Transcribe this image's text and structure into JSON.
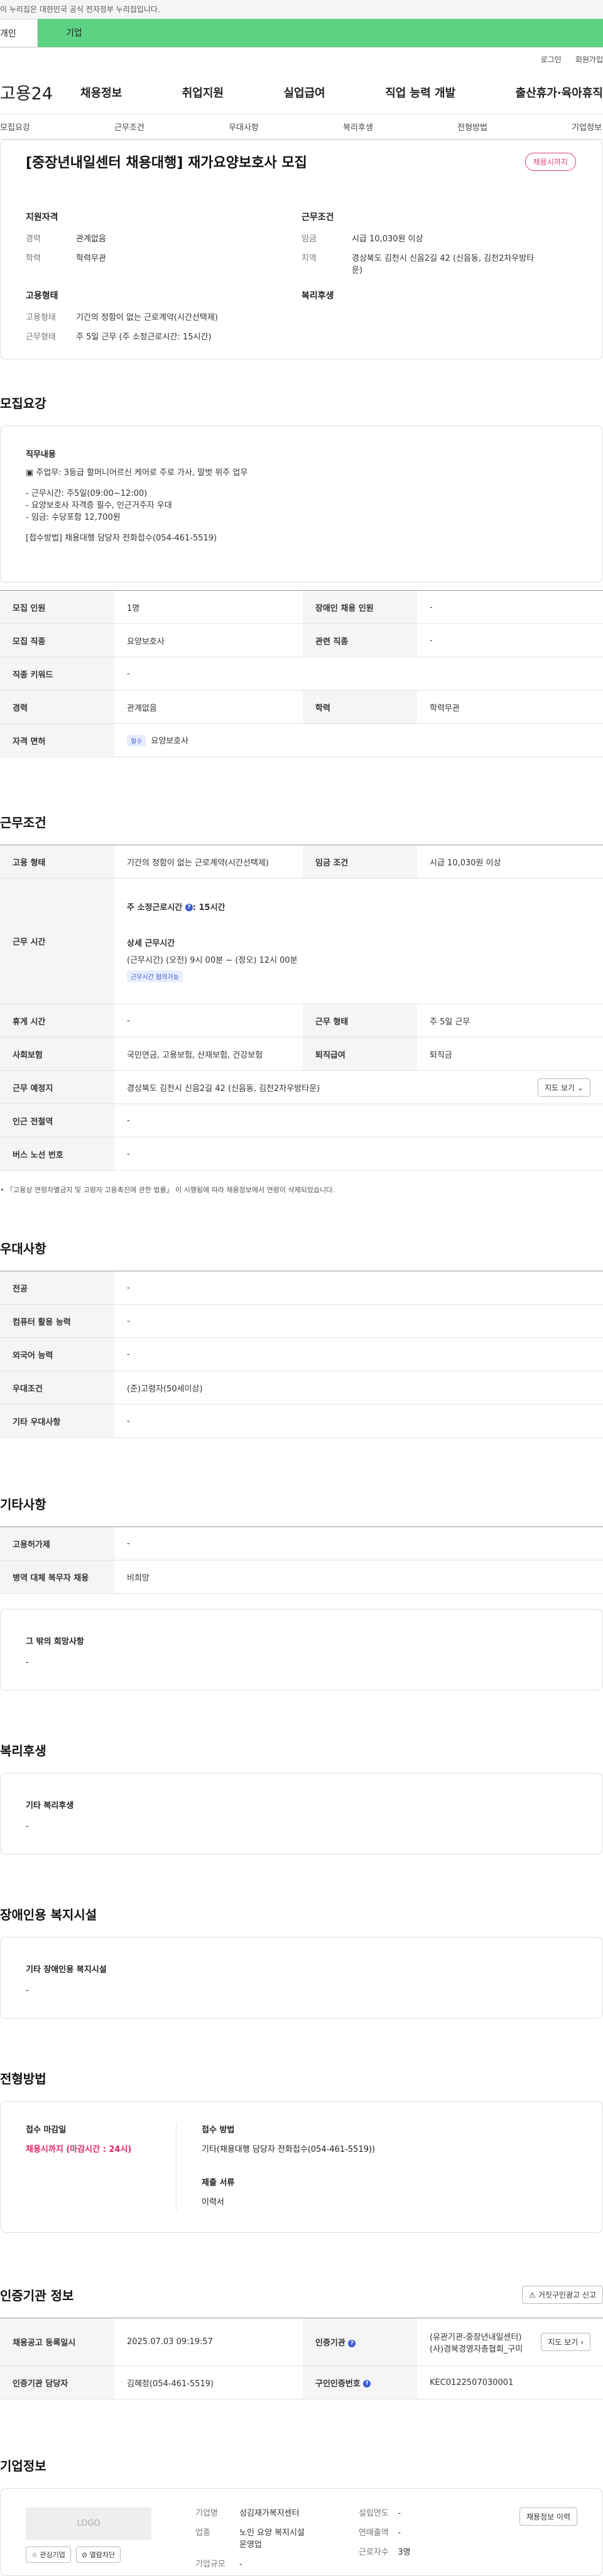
{
  "notice": "이 누리집은 대한민국 공식 전자정부 누리집입니다.",
  "tabs": {
    "personal": "개인",
    "company": "기업"
  },
  "util": {
    "login": "로그인",
    "join": "회원가입"
  },
  "logo": "고용24",
  "gnb": [
    "채용정보",
    "취업지원",
    "실업급여",
    "직업 능력 개발",
    "출산휴가·육아휴직"
  ],
  "lnb": [
    "모집요강",
    "근무조건",
    "우대사항",
    "복리후생",
    "전형방법",
    "기업정보"
  ],
  "summary": {
    "title": "[중장년내일센터 채용대행] 재가요양보호사 모집",
    "badge": "채용시까지",
    "qual_title": "지원자격",
    "cond_title": "근무조건",
    "emp_title": "고용형태",
    "welfare_title": "복리후생",
    "qual": [
      {
        "k": "경력",
        "v": "관계없음"
      },
      {
        "k": "학력",
        "v": "학력무관"
      }
    ],
    "cond": [
      {
        "k": "임금",
        "v": "시급 10,030원 이상"
      },
      {
        "k": "지역",
        "v": "경상북도 김천시 신음2길 42 (신음동, 김천2차우방타운)"
      }
    ],
    "emp": [
      {
        "k": "고용형태",
        "v": "기간의 정함이 없는 근로계약(시간선택제)"
      },
      {
        "k": "근무형태",
        "v": "주 5일 근무 (주 소정근로시간: 15시간)"
      }
    ]
  },
  "recruit": {
    "title": "모집요강",
    "duty_title": "직무내용",
    "duty_lines": [
      "▣ 주업무: 3등급 할머니어르신 케어로 주로 가사, 말벗 위주 업무",
      "",
      "- 근무시간: 주5일(09:00~12:00)",
      "- 요양보호사 자격증 필수, 인근거주자 우대",
      "- 임금: 수당포함 12,700원",
      "",
      "[접수방법] 채용대행 담당자 전화접수(054-461-5519)"
    ],
    "rows": {
      "h_people": "모집 인원",
      "people": "1명",
      "h_disabled": "장애인 채용 인원",
      "disabled": "-",
      "h_job": "모집 직종",
      "job": "요양보호사",
      "h_related": "관련 직종",
      "related": "-",
      "h_keyword": "직종 키워드",
      "keyword": "-",
      "h_career": "경력",
      "career": "관계없음",
      "h_edu": "학력",
      "edu": "학력무관",
      "h_license": "자격 면허",
      "license_tag": "필수",
      "license": "요양보호사"
    }
  },
  "work": {
    "title": "근무조건",
    "h_emp": "고용 형태",
    "emp": "기간의 정함이 없는 근로계약(시간선택제)",
    "h_wage": "임금 조건",
    "wage": "시급 10,030원 이상",
    "h_time": "근무 시간",
    "time_label": "주 소정근로시간",
    "time_value": ": 15시간",
    "time_detail_title": "상세 근무시간",
    "time_detail": "(근무시간) (오전) 9시 00분 ~ (정오) 12시 00분",
    "time_tag": "근무시간 협의가능",
    "h_holiday": "휴게 시간",
    "holiday": "-",
    "h_shape": "근무 형태",
    "shape": "주 5일 근무",
    "h_insure": "사회보험",
    "insure": "국민연금, 고용보험, 산재보험, 건강보험",
    "h_retire": "퇴직급여",
    "retire": "퇴직금",
    "h_place": "근무 예정지",
    "place": "경상북도 김천시 신음2길 42 (신음동, 김천2차우방타운)",
    "map_btn": "지도 보기",
    "h_subway": "인근 전철역",
    "subway": "-",
    "h_bus": "버스 노선 번호",
    "bus": "-",
    "note": "• 「고용상 연령차별금지 및 고령자 고용촉진에 관한 법률」 이 시행됨에 따라 채용정보에서 연령이 삭제되었습니다."
  },
  "prefer": {
    "title": "우대사항",
    "rows": [
      {
        "k": "전공",
        "v": "-"
      },
      {
        "k": "컴퓨터 활용 능력",
        "v": "-"
      },
      {
        "k": "외국어 능력",
        "v": "-"
      },
      {
        "k": "우대조건",
        "v": "(준)고령자(50세이상)"
      },
      {
        "k": "기타 우대사항",
        "v": "-"
      }
    ]
  },
  "etc": {
    "title": "기타사항",
    "rows": [
      {
        "k": "고용허가제",
        "v": "-"
      },
      {
        "k": "병역 대체 복무자 채용",
        "v": "비희망"
      }
    ],
    "hope_title": "그 밖의 희망사항",
    "hope": "-"
  },
  "welfare": {
    "title": "복리후생",
    "box_title": "기타 복리후생",
    "box": "-"
  },
  "facility": {
    "title": "장애인용 복지시설",
    "box_title": "기타 장애인용 복지시설",
    "box": "-"
  },
  "process": {
    "title": "전형방법",
    "deadline_title": "접수 마감일",
    "deadline": "채용시까지 (마감시간 : 24시)",
    "method_title": "접수 방법",
    "method": "기타(채용대행 담당자 전화접수(054-461-5519))",
    "docs_title": "제출 서류",
    "docs": "이력서"
  },
  "cert": {
    "title": "인증기관 정보",
    "report_btn": "거짓구인광고 신고",
    "h_reg": "채용공고 등록일시",
    "reg": "2025.07.03 09:19:57",
    "h_org": "인증기관",
    "org1": "(유관기관-중장년내일센터)",
    "org2": "(사)경북경영자총협회_구미",
    "map_btn": "지도 보기",
    "h_manager": "인증기관 담당자",
    "manager": "김혜정(054-461-5519)",
    "h_num": "구인인증번호",
    "num": "KEC0122507030001"
  },
  "company": {
    "title": "기업정보",
    "logo": "LOGO",
    "fav_btn": "관심기업",
    "block_btn": "열람차단",
    "h_name": "기업명",
    "name": "성김재가복지센터",
    "h_industry": "업종",
    "industry": "노인 요양 복지시설 운영업",
    "h_scale": "기업규모",
    "scale": "-",
    "h_year": "설립연도",
    "year": "-",
    "h_sales": "연매출액",
    "sales": "-",
    "h_workers": "근로자수",
    "workers": "3명",
    "hist_btn": "채용정보 이력"
  }
}
